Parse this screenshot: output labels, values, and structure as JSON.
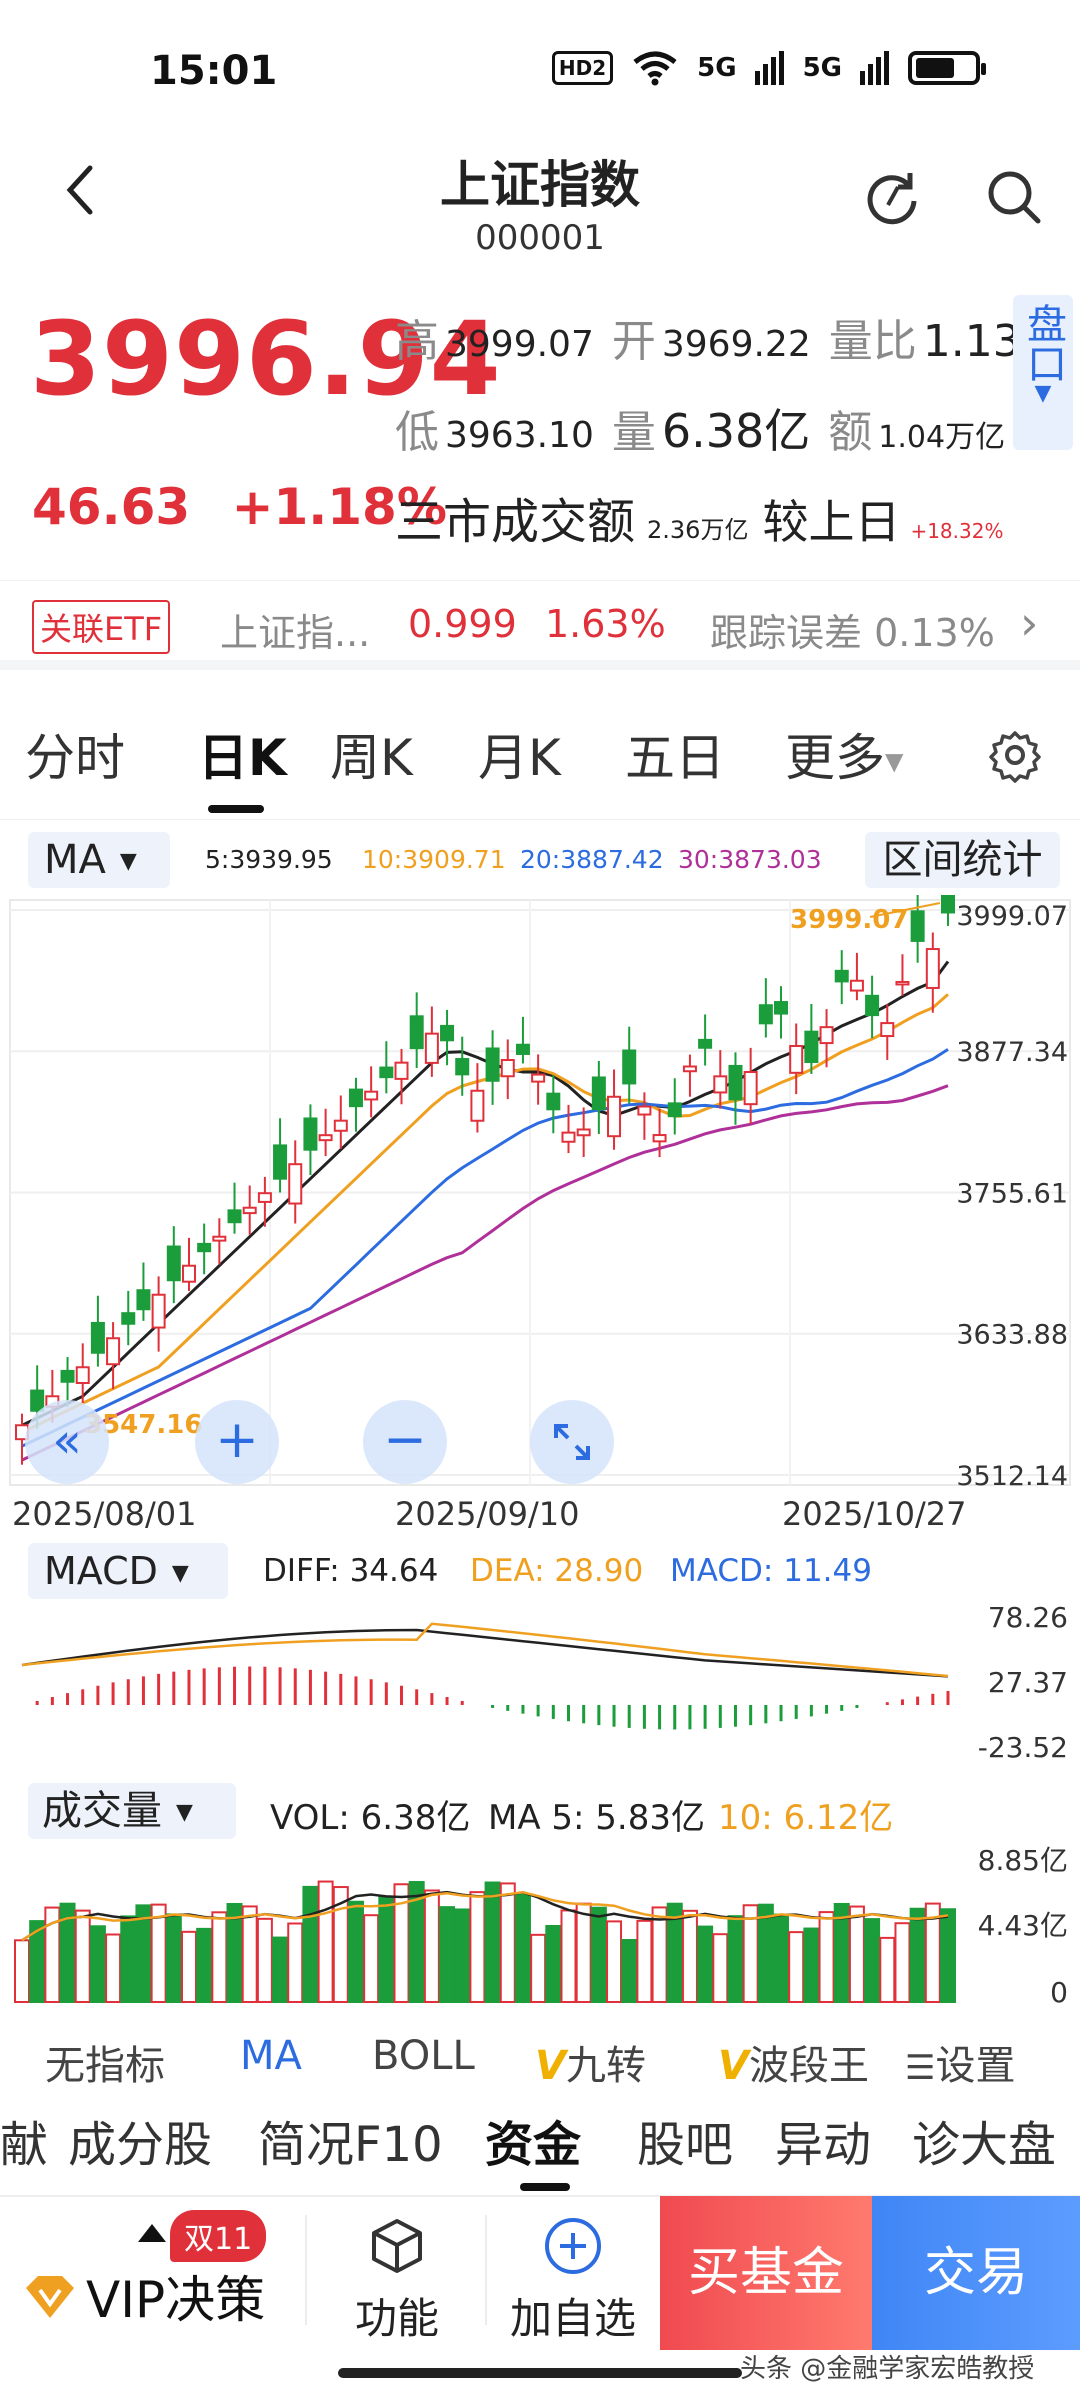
{
  "status_bar": {
    "time": "15:01",
    "hd": "HD2",
    "signal1": "5G",
    "signal2": "5G"
  },
  "header": {
    "title": "上证指数",
    "code": "000001"
  },
  "quote": {
    "price": "3996.94",
    "high_label": "高",
    "high": "3999.07",
    "open_label": "开",
    "open": "3969.22",
    "vol_ratio_label": "量比",
    "vol_ratio": "1.13",
    "low_label": "低",
    "low": "3963.10",
    "volume_label": "量",
    "volume": "6.38亿",
    "amount_label": "额",
    "amount": "1.04万亿",
    "change": "46.63",
    "change_pct": "+1.18%",
    "market_label": "三市成交额",
    "market_value": "2.36万亿",
    "compare_label": "较上日",
    "compare_value": "+18.32%",
    "panel_label": "盘口"
  },
  "etf": {
    "tag": "关联ETF",
    "name": "上证指...",
    "price": "0.999",
    "pct": "1.63%",
    "tracking": "跟踪误差 0.13%"
  },
  "tabs": [
    "分时",
    "日K",
    "周K",
    "月K",
    "五日",
    "更多"
  ],
  "ma_legend": {
    "select": "MA",
    "ma5": "5:3939.95",
    "ma10": "10:3909.71",
    "ma20": "20:3887.42",
    "ma30": "30:3873.03",
    "range_stats": "区间统计"
  },
  "kline": {
    "y_ticks": [
      "3999.07",
      "3877.34",
      "3755.61",
      "3633.88",
      "3512.14"
    ],
    "high_label": "3999.07",
    "low_label": "3547.16",
    "dates": [
      "2025/08/01",
      "2025/09/10",
      "2025/10/27"
    ]
  },
  "macd": {
    "select": "MACD",
    "diff": "DIFF: 34.64",
    "dea": "DEA: 28.90",
    "macd": "MACD: 11.49",
    "y_ticks": [
      "78.26",
      "27.37",
      "-23.52"
    ]
  },
  "volume": {
    "select": "成交量",
    "vol": "VOL: 6.38亿",
    "ma5": "MA 5: 5.83亿",
    "ma10": "10: 6.12亿",
    "y_ticks": [
      "8.85亿",
      "4.43亿",
      "0"
    ]
  },
  "indicator_tabs": {
    "none": "无指标",
    "ma": "MA",
    "boll": "BOLL",
    "jiuzhuan": "九转",
    "boduan": "波段王",
    "settings": "设置",
    "v": "V"
  },
  "sub_tabs": [
    "献",
    "成分股",
    "简况F10",
    "资金",
    "股吧",
    "异动",
    "诊大盘"
  ],
  "bottom": {
    "vip_badge": "双11",
    "vip_label": "VIP决策",
    "func_label": "功能",
    "add_label": "加自选",
    "buy_fund": "买基金",
    "trade": "交易"
  },
  "watermark": "头条 @金融学家宏皓教授",
  "colors": {
    "up": "#e0303a",
    "down": "#1a9d3a",
    "ma5": "#222222",
    "ma10": "#f0a020",
    "ma20": "#2c6ce0",
    "ma30": "#b0309a",
    "accent": "#2c6ce0"
  }
}
